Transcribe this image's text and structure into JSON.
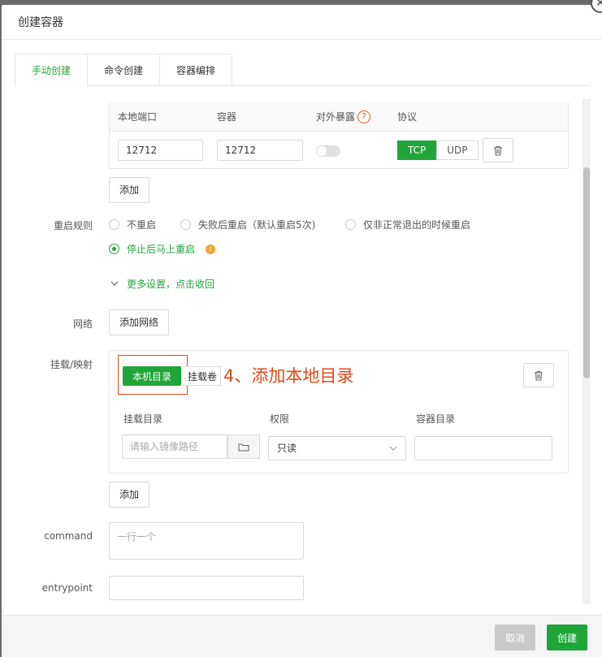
{
  "dialog": {
    "title": "创建容器"
  },
  "tabs": [
    {
      "label": "手动创建"
    },
    {
      "label": "命令创建"
    },
    {
      "label": "容器编排"
    }
  ],
  "ports": {
    "headers": {
      "local_port": "本地端口",
      "container": "容器",
      "expose": "对外暴露",
      "protocol": "协议"
    },
    "help": "?",
    "row": {
      "local_port": "12712",
      "container_port": "12712",
      "tcp": "TCP",
      "udp": "UDP"
    },
    "add_label": "添加"
  },
  "restart": {
    "label": "重启规则",
    "options": [
      "不重启",
      "失败后重启（默认重启5次)",
      "仅非正常退出的时候重启",
      "停止后马上重启"
    ],
    "selected": "停止后马上重启"
  },
  "more_settings": "更多设置，点击收回",
  "network": {
    "label": "网络",
    "add_label": "添加网络"
  },
  "mount": {
    "label": "挂载/映射",
    "btn_local": "本机目录",
    "btn_volume": "挂载卷",
    "annotation": "4、添加本地目录",
    "col_dir": "挂载目录",
    "col_perm": "权限",
    "col_container_dir": "容器目录",
    "dir_placeholder": "请输入镜像路径",
    "perm_value": "只读",
    "add_label": "添加"
  },
  "command": {
    "label": "command",
    "placeholder": "一行一个"
  },
  "entrypoint": {
    "label": "entrypoint"
  },
  "footer": {
    "cancel": "取消",
    "create": "创建"
  },
  "colors": {
    "accent": "#20a53a",
    "annotation": "#e04a1a"
  }
}
